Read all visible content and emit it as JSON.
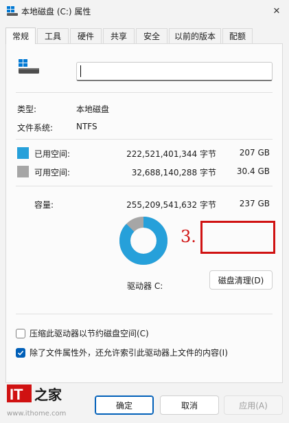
{
  "window": {
    "title": "本地磁盘 (C:) 属性",
    "close_glyph": "✕"
  },
  "tabs": [
    {
      "label": "常规",
      "active": true
    },
    {
      "label": "工具"
    },
    {
      "label": "硬件"
    },
    {
      "label": "共享"
    },
    {
      "label": "安全"
    },
    {
      "label": "以前的版本"
    },
    {
      "label": "配额"
    }
  ],
  "general": {
    "drive_name_value": "",
    "type_label": "类型:",
    "type_value": "本地磁盘",
    "fs_label": "文件系统:",
    "fs_value": "NTFS",
    "used_label": "已用空间:",
    "used_bytes": "222,521,401,344 字节",
    "used_size": "207 GB",
    "free_label": "可用空间:",
    "free_bytes": "32,688,140,288 字节",
    "free_size": "30.4 GB",
    "capacity_label": "容量:",
    "capacity_bytes": "255,209,541,632 字节",
    "capacity_size": "237 GB",
    "drive_label": "驱动器 C:",
    "cleanup_button": "磁盘清理(D)",
    "step_annotation": "3.",
    "compress_label": "压缩此驱动器以节约磁盘空间(C)",
    "compress_checked": false,
    "index_label": "除了文件属性外，还允许索引此驱动器上文件的内容(I)",
    "index_checked": true
  },
  "usage": {
    "used_fraction": 0.872,
    "used_color": "#26a0da",
    "free_color": "#a6a6a6"
  },
  "buttons": {
    "ok": "确定",
    "cancel": "取消",
    "apply": "应用(A)"
  },
  "branding": {
    "logo_text": "IT之家",
    "watermark": "www.ithome.com"
  },
  "colors": {
    "accent": "#005fb8",
    "highlight": "#d01212"
  }
}
